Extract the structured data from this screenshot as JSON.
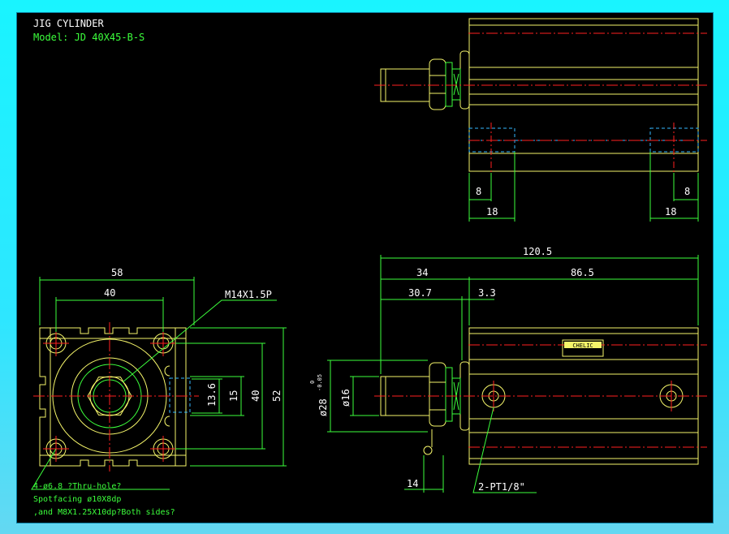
{
  "title": "JIG CYLINDER",
  "model": "Model: JD 40X45-B-S",
  "colors": {
    "background": "#000000",
    "outline": "#f5f56a",
    "centerline": "#ff2020",
    "dimension": "#3cff3c",
    "hidden": "#35b7ff",
    "label_white": "#ffffff"
  },
  "front_view": {
    "dim_overall_width": "58",
    "dim_bolt_pitch": "40",
    "dim_port_13_6": "13.6",
    "dim_15": "15",
    "dim_40_vertical": "40",
    "dim_52_vertical": "52",
    "thread_callout": "M14X1.5P",
    "hole_note": "4-ø6.8 ?Thru-hole?",
    "spotfacing_note": "Spotfacing  ø10X8dp",
    "thread_note": ",and M8X1.25X10dp?Both sides?"
  },
  "side_view": {
    "dim_overall": "120.5",
    "dim_34": "34",
    "dim_86_5": "86.5",
    "dim_30_7": "30.7",
    "dim_3_3": "3.3",
    "dim_rod_dia": "ø16",
    "dim_boss_dia": "ø28",
    "tolerance_top": "0",
    "tolerance_bottom": "-0.05",
    "dim_14": "14",
    "port_note": "2-PT1/8\"",
    "logo_text": "CHELIC"
  },
  "top_view": {
    "dim_8_left": "8",
    "dim_8_right": "8",
    "dim_18_left": "18",
    "dim_18_right": "18"
  }
}
